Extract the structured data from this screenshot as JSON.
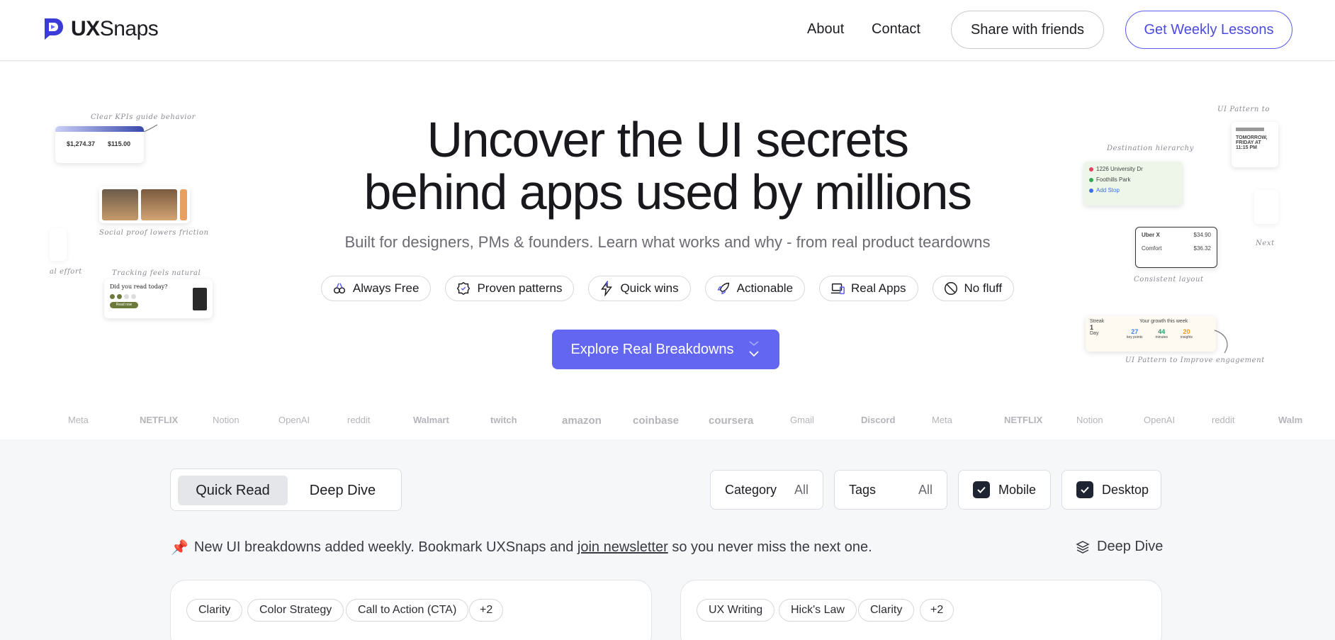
{
  "header": {
    "logo_bold": "UX",
    "logo_rest": "Snaps",
    "nav": [
      "About",
      "Contact"
    ],
    "share_label": "Share with friends",
    "lessons_label": "Get Weekly Lessons",
    "accent_color": "#5b5bf0"
  },
  "hero": {
    "title_line1": "Uncover the UI secrets",
    "title_line2": "behind apps used by millions",
    "subtitle": "Built for designers, PMs & founders. Learn what works and why - from real product teardowns",
    "chips": [
      {
        "label": "Always Free",
        "icon": "free-icon"
      },
      {
        "label": "Proven patterns",
        "icon": "badge-check-icon"
      },
      {
        "label": "Quick wins",
        "icon": "lightning-icon"
      },
      {
        "label": "Actionable",
        "icon": "rocket-icon"
      },
      {
        "label": "Real Apps",
        "icon": "devices-icon"
      },
      {
        "label": "No fluff",
        "icon": "ban-icon"
      }
    ],
    "cta_label": "Explore Real Breakdowns",
    "cta_color": "#6366f1"
  },
  "previews": {
    "left": {
      "kpi_note": "Clear KPIs guide behavior",
      "kpi_value_1": "$1,274.37",
      "kpi_value_2": "$115.00",
      "social_note": "Social proof lowers friction",
      "tracking_note": "Tracking feels natural",
      "tracking_question": "Did you read today?",
      "tracking_button": "Read now",
      "effort_note": "al effort"
    },
    "right": {
      "pattern_note_top": "UI Pattern to",
      "destination_note": "Destination hierarchy",
      "destination_items": [
        "1226 University Dr",
        "Foothills Park",
        "Add Stop"
      ],
      "reminder_title": "TOMORROW, FRIDAY AT 11:15 PM",
      "ride_items": [
        {
          "name": "Uber X",
          "price": "$34.90"
        },
        {
          "name": "Comfort",
          "price": "$36.32"
        }
      ],
      "layout_note": "Consistent layout",
      "growth_title": "Your growth this week",
      "streak_label": "Streak",
      "streak_value": "1",
      "streak_unit": "Day",
      "growth_stats": [
        {
          "value": "27",
          "label": "key points",
          "color": "#3b82f6"
        },
        {
          "value": "44",
          "label": "minutes",
          "color": "#22a06b"
        },
        {
          "value": "20",
          "label": "insights",
          "color": "#f59e0b"
        }
      ],
      "engagement_note": "UI Pattern to Improve engagement",
      "next_note": "Next"
    }
  },
  "brands": [
    "Meta",
    "NETFLIX",
    "Notion",
    "OpenAI",
    "reddit",
    "Walmart",
    "twitch",
    "amazon",
    "coinbase",
    "coursera",
    "Gmail",
    "Discord",
    "Meta",
    "NETFLIX",
    "Notion",
    "OpenAI",
    "reddit",
    "Walm"
  ],
  "controls": {
    "modes": [
      "Quick Read",
      "Deep Dive"
    ],
    "category_label": "Category",
    "category_value": "All",
    "tags_label": "Tags",
    "tags_value": "All",
    "mobile_label": "Mobile",
    "desktop_label": "Desktop"
  },
  "notice": {
    "pin": "📌",
    "before": "New UI breakdowns added weekly. Bookmark UXSnaps and ",
    "link": "join newsletter",
    "after": " so you never miss the next one.",
    "deep_dive": "Deep Dive"
  },
  "cards": [
    {
      "tags": [
        "Clarity",
        "Color Strategy",
        "Call to Action (CTA)",
        "+2"
      ]
    },
    {
      "tags": [
        "UX Writing",
        "Hick's Law",
        "Clarity",
        "+2"
      ]
    }
  ]
}
